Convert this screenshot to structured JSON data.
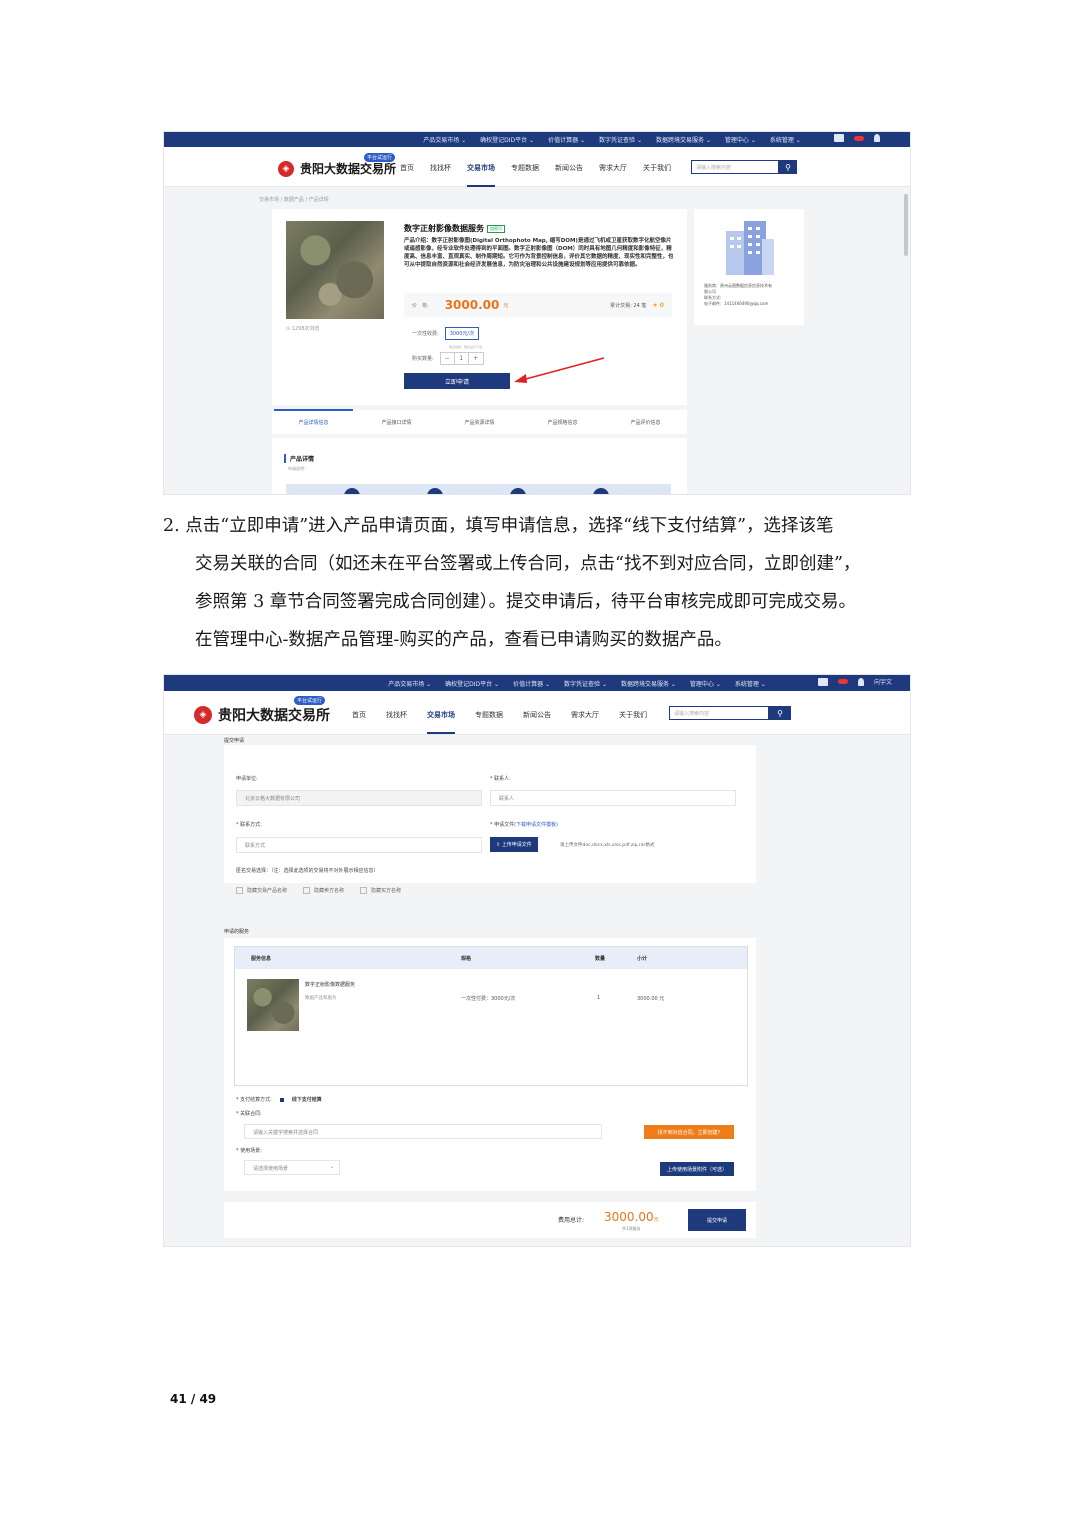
{
  "shot1": {
    "topnav": [
      "产品交易市场 ⌄",
      "确权登记DID平台 ⌄",
      "价值计算器 ⌄",
      "数字凭证查验 ⌄",
      "数据跨境交易服务 ⌄",
      "管理中心 ⌄",
      "系统管理 ⌄"
    ],
    "brand": "贵阳大数据交易所",
    "logo_glyph": "◈",
    "platform_tag": "平台试运行",
    "nav": [
      "首页",
      "找找杯",
      "交易市场",
      "专题数据",
      "新闻公告",
      "需求大厅",
      "关于我们"
    ],
    "search_placeholder": "请输入搜索内容",
    "breadcrumb": "交易市场 / 数据产品 / 产品详情",
    "product_title": "数字正射影像数据服务",
    "product_tag": "加密可",
    "product_desc": "产品介绍：数字正射影像图(Digital Orthophoto Map, 缩写DOM)是通过飞机或卫星获取数字化航空像片或遥感影像，经专业软件处理得到的平面图。数字正射影像图（DOM）同时具有地图几何精度和影像特征，精度高、信息丰富、直观真实、制作周期短。它可作为背景控制信息，评价其它数据的精度、现实性和完整性，也可从中提取自然资源和社会经济发展信息，为防灾治理和公共设施建设规划等应用提供可靠依据。",
    "views": "⊙ 1298次浏览",
    "price_label": "价　格:",
    "price": "3000.00",
    "price_unit": "元",
    "sales": "累计交易: 24 笔",
    "rating": "★ 0",
    "spec_label": "一次性收费:",
    "spec_value": "3000元/次",
    "spec_note": "购买规则：购买后可下载",
    "qty_label": "购买数量:",
    "qty_minus": "−",
    "qty": "1",
    "qty_plus": "+",
    "apply_button": "立即申请",
    "seller_lines": [
      "服务商：贵州云图数据信息信息技术有",
      "限公司",
      "联系方式:",
      "电子邮件：1411466490@qq.com"
    ],
    "tabs": [
      "产品详情信息",
      "产品接口详情",
      "产品资源详情",
      "产品规格信息",
      "产品评价信息"
    ],
    "detail_title": "产品详情",
    "detail_sub": "申请说明："
  },
  "paragraph": {
    "lines": [
      "2.  点击“立即申请”进入产品申请页面，填写申请信息，选择“线下支付结算”，选择该笔",
      "交易关联的合同（如还未在平台签署或上传合同，点击“找不到对应合同，立即创建”，",
      "参照第 3 章节合同签署完成合同创建）。提交申请后，待平台审核完成即可完成交易。",
      "在管理中心-数据产品管理-购买的产品，查看已申请购买的数据产品。"
    ]
  },
  "shot2": {
    "topnav": [
      "产品交易市场 ⌄",
      "确权登记DID平台 ⌄",
      "价值计算器 ⌄",
      "数字凭证查验 ⌄",
      "数据跨境交易服务 ⌄",
      "管理中心 ⌄",
      "系统管理 ⌄"
    ],
    "user": "向宇文",
    "brand": "贵阳大数据交易所",
    "logo_glyph": "◈",
    "platform_tag": "平台试运行",
    "nav": [
      "首页",
      "找找杯",
      "交易市场",
      "专题数据",
      "新闻公告",
      "需求大厅",
      "关于我们"
    ],
    "search_placeholder": "请输入搜索内容",
    "section_apply": "提交申请",
    "org_label": "申请单位:",
    "org_value": "北京云格大数据有限公司",
    "contact_label": "* 联系人:",
    "contact_placeholder": "联系人",
    "phone_label": "* 联系方式:",
    "phone_placeholder": "联系方式",
    "file_label": "* 申请文件",
    "file_link": "(下载申请文件模板)",
    "upload_button": "⇪ 上传申请文件",
    "file_hint": "请上传文件doc,docx,xls,xlsx,pdf,zip,rar格式",
    "privacy_label": "匿名交易选择：（注：选择此选项的交易将不对外展示相应信息）",
    "privacy_options": [
      "隐藏交易产品名称",
      "隐藏卖方名称",
      "隐藏买方名称"
    ],
    "section_products": "申请的服务",
    "table_headers": [
      "服务信息",
      "规格",
      "数量",
      "小计"
    ],
    "row_title": "数字正射影像数据服务",
    "row_sub": "数据产品和服务",
    "row_spec": "一次性付费：3000元/次",
    "row_qty": "1",
    "row_subtotal": "3000.00 元",
    "pay_label": "* 支付结算方式:",
    "pay_option": "线下支付结算",
    "contract_label": "* 关联合同:",
    "contract_placeholder": "请输入关键字搜索并选择合同",
    "contract_button": "找不到对应合同，立即创建?",
    "usage_label": "* 使用场景:",
    "usage_placeholder": "请选择使用场景",
    "usage_caret": "⌄",
    "usage_button": "上传使用场景附件（可选）",
    "total_label": "费用总计:",
    "total_value": "3000.00",
    "total_unit": "元",
    "total_sub": "共1项服务",
    "submit_button": "提交申请"
  },
  "page_number": "41 / 49"
}
